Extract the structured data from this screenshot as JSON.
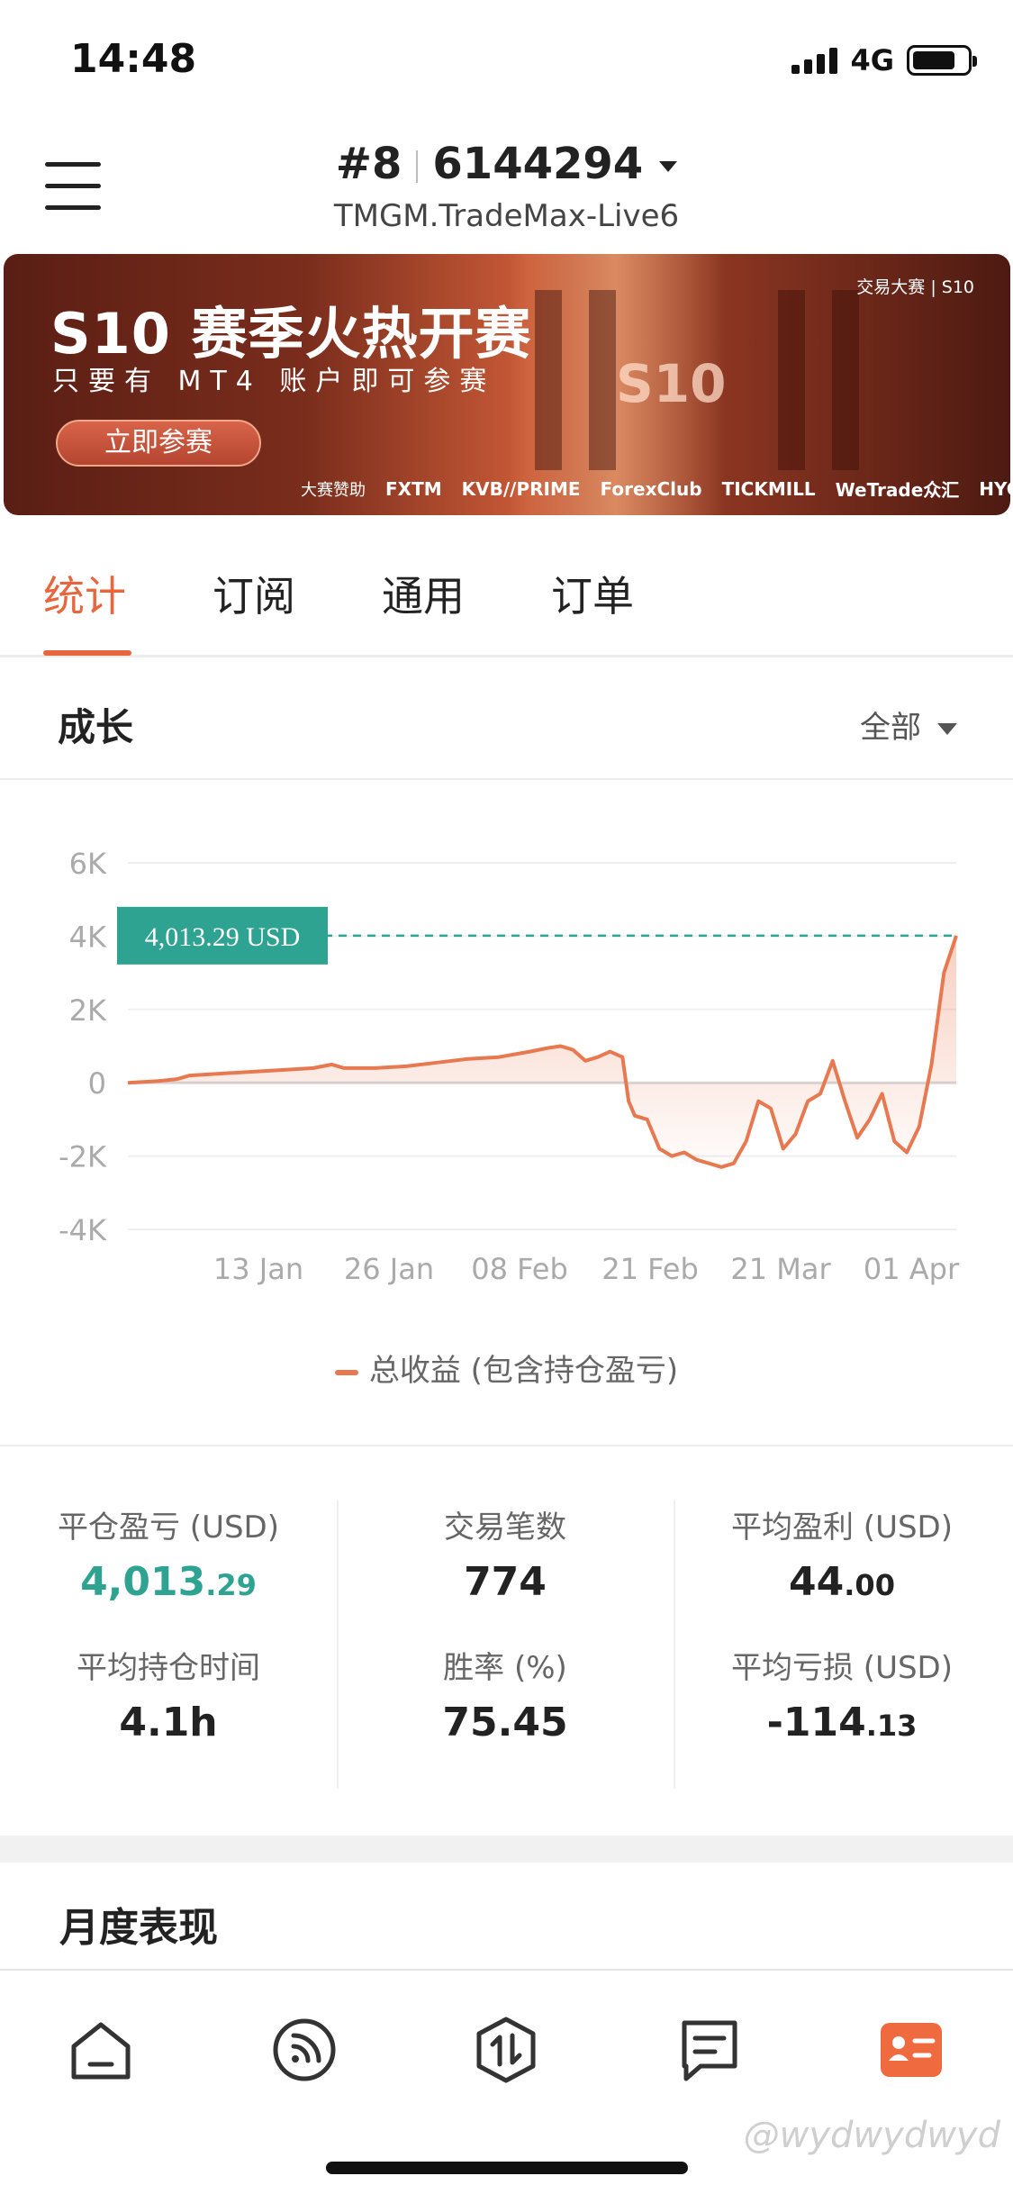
{
  "status_bar": {
    "time": "14:48",
    "network": "4G"
  },
  "header": {
    "rank": "#8",
    "account_id": "6144294",
    "server": "TMGM.TradeMax-Live6"
  },
  "banner": {
    "title": "S10 赛季火热开赛",
    "subtitle": "只要有 MT4 账户即可参赛",
    "button": "立即参赛",
    "brand": "交易大赛 | S10",
    "big_text": "S10",
    "sponsor_label": "大赛赞助",
    "sponsors": [
      "FXTM",
      "KVB//PRIME",
      "ForexClub",
      "TICKMILL",
      "WeTrade众汇",
      "HYCM"
    ]
  },
  "tabs": [
    {
      "label": "统计",
      "active": true
    },
    {
      "label": "订阅",
      "active": false
    },
    {
      "label": "通用",
      "active": false
    },
    {
      "label": "订单",
      "active": false
    }
  ],
  "growth": {
    "title": "成长",
    "filter": "全部"
  },
  "chart_data": {
    "type": "area",
    "y_ticks": [
      "6K",
      "4K",
      "2K",
      "0",
      "-2K",
      "-4K"
    ],
    "ylim": [
      -4000,
      6000
    ],
    "x_ticks": [
      "13 Jan",
      "26 Jan",
      "08 Feb",
      "21 Feb",
      "21 Mar",
      "01 Apr"
    ],
    "current_value_label": "4,013.29 USD",
    "current_value": 4013.29,
    "series": [
      {
        "name": "总收益 (包含持仓盈亏)",
        "color": "#e8784f",
        "points": [
          [
            0,
            0
          ],
          [
            0.05,
            50
          ],
          [
            0.08,
            100
          ],
          [
            0.1,
            200
          ],
          [
            0.15,
            250
          ],
          [
            0.2,
            300
          ],
          [
            0.25,
            350
          ],
          [
            0.3,
            400
          ],
          [
            0.33,
            500
          ],
          [
            0.35,
            400
          ],
          [
            0.4,
            400
          ],
          [
            0.45,
            450
          ],
          [
            0.5,
            550
          ],
          [
            0.55,
            650
          ],
          [
            0.6,
            700
          ],
          [
            0.65,
            850
          ],
          [
            0.68,
            950
          ],
          [
            0.7,
            1000
          ],
          [
            0.72,
            900
          ],
          [
            0.74,
            600
          ],
          [
            0.76,
            700
          ],
          [
            0.78,
            850
          ],
          [
            0.8,
            700
          ],
          [
            0.81,
            -500
          ],
          [
            0.82,
            -900
          ],
          [
            0.84,
            -1000
          ],
          [
            0.86,
            -1800
          ],
          [
            0.88,
            -2000
          ],
          [
            0.9,
            -1900
          ],
          [
            0.92,
            -2100
          ],
          [
            0.94,
            -2200
          ],
          [
            0.96,
            -2300
          ],
          [
            0.98,
            -2200
          ],
          [
            1.0,
            -1600
          ],
          [
            1.02,
            -500
          ],
          [
            1.04,
            -700
          ],
          [
            1.06,
            -1800
          ],
          [
            1.08,
            -1400
          ],
          [
            1.1,
            -500
          ],
          [
            1.12,
            -300
          ],
          [
            1.14,
            600
          ],
          [
            1.16,
            -500
          ],
          [
            1.18,
            -1500
          ],
          [
            1.2,
            -1000
          ],
          [
            1.22,
            -300
          ],
          [
            1.24,
            -1600
          ],
          [
            1.26,
            -1900
          ],
          [
            1.28,
            -1200
          ],
          [
            1.3,
            500
          ],
          [
            1.32,
            3000
          ],
          [
            1.34,
            4013.29
          ]
        ]
      }
    ]
  },
  "stats": [
    {
      "label": "平仓盈亏 (USD)",
      "int": "4,013",
      "dec": ".29",
      "positive": true
    },
    {
      "label": "交易笔数",
      "int": "774",
      "dec": "",
      "positive": false
    },
    {
      "label": "平均盈利 (USD)",
      "int": "44",
      "dec": ".00",
      "positive": false
    },
    {
      "label": "平均持仓时间",
      "int": "4.1h",
      "dec": "",
      "positive": false
    },
    {
      "label": "胜率 (%)",
      "int": "75.45",
      "dec": "",
      "positive": false
    },
    {
      "label": "平均亏损 (USD)",
      "int": "-114",
      "dec": ".13",
      "positive": false
    }
  ],
  "monthly": {
    "title": "月度表现"
  },
  "nav": [
    {
      "icon": "home-icon"
    },
    {
      "icon": "feed-icon"
    },
    {
      "icon": "trade-icon"
    },
    {
      "icon": "message-icon"
    },
    {
      "icon": "profile-icon",
      "active": true
    }
  ],
  "watermark": "@wydwydwyd",
  "colors": {
    "accent": "#e8663d",
    "positive": "#2fa392",
    "line": "#e8784f"
  }
}
